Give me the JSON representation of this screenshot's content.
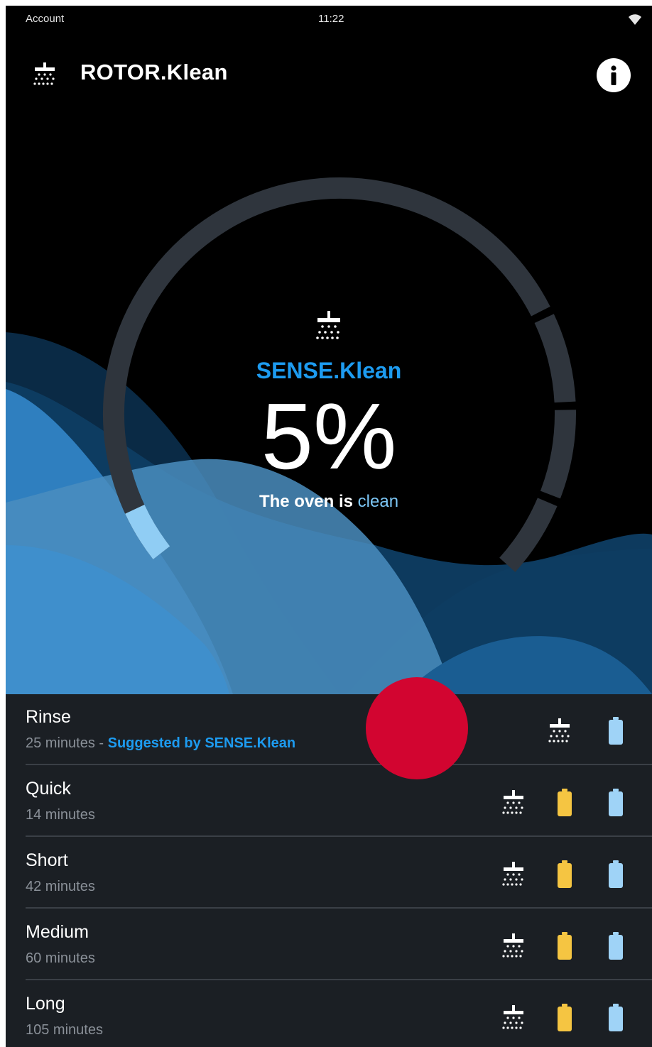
{
  "status_bar": {
    "left_label": "Account",
    "time": "11:22",
    "wifi_icon": "wifi-icon"
  },
  "app_bar": {
    "title": "ROTOR.Klean",
    "logo_icon": "shower-icon",
    "info_icon": "info-icon"
  },
  "gauge": {
    "icon": "shower-icon",
    "label": "SENSE.Klean",
    "value_text": "5%",
    "value": 5,
    "status_prefix": "The oven is",
    "status_state": "clean",
    "colors": {
      "track": "#2f353d",
      "fill": "#90cdf4",
      "accent": "#1d9bf0"
    }
  },
  "programs": [
    {
      "name": "Rinse",
      "duration": "25 minutes",
      "separator": " - ",
      "suggestion": "Suggested by SENSE.Klean",
      "icons": [
        "shower-icon",
        "battery-blue-icon"
      ]
    },
    {
      "name": "Quick",
      "duration": "14 minutes",
      "icons": [
        "shower-icon",
        "battery-yellow-icon",
        "battery-blue-icon"
      ]
    },
    {
      "name": "Short",
      "duration": "42 minutes",
      "icons": [
        "shower-icon",
        "battery-yellow-icon",
        "battery-blue-icon"
      ]
    },
    {
      "name": "Medium",
      "duration": "60 minutes",
      "icons": [
        "shower-icon",
        "battery-yellow-icon",
        "battery-blue-icon"
      ]
    },
    {
      "name": "Long",
      "duration": "105 minutes",
      "icons": [
        "shower-icon",
        "battery-yellow-icon",
        "battery-blue-icon"
      ]
    }
  ],
  "colors": {
    "background": "#000000",
    "list_background": "#1b1f24",
    "yellow": "#f5c542",
    "blue": "#9fd3f7",
    "touch": "#d20530"
  }
}
